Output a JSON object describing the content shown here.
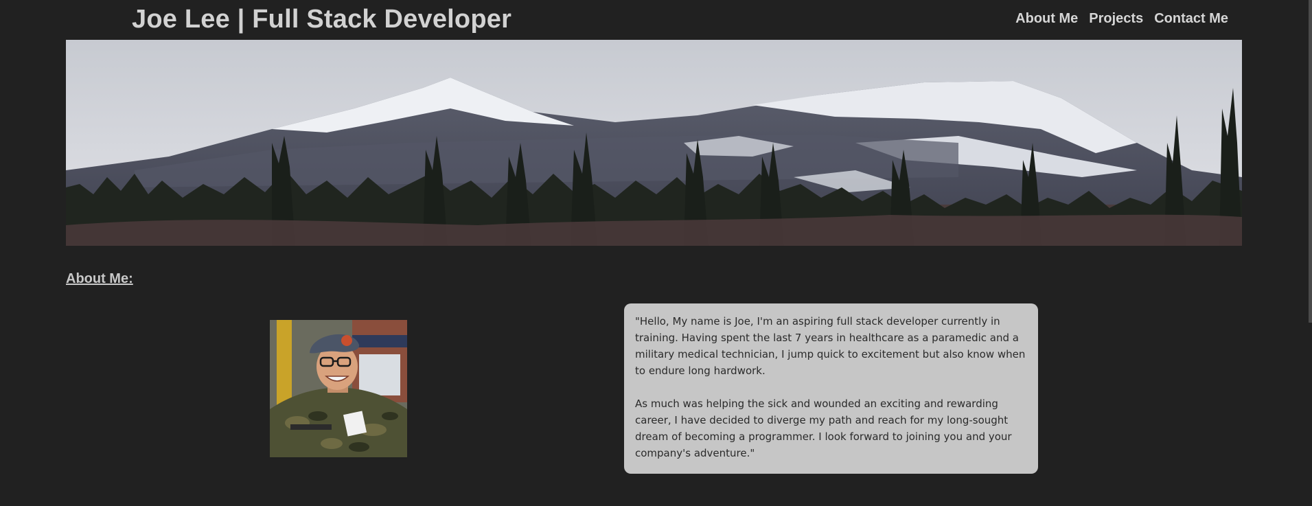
{
  "header": {
    "title": "Joe Lee | Full Stack Developer",
    "nav": [
      {
        "label": "About Me"
      },
      {
        "label": "Projects"
      },
      {
        "label": "Contact Me"
      }
    ]
  },
  "about": {
    "heading": "About Me:",
    "paragraphs": [
      "\"Hello, My name is Joe, I'm an aspiring full stack developer currently in training. Having spent the last 7 years in healthcare as a paramedic and a military medical technician, I jump quick to excitement but also know when to endure long hardwork.",
      "As much was helping the sick and wounded an exciting and rewarding career, I have decided to diverge my path and reach for my long-sought dream of becoming a programmer. I look forward to joining you and your company's adventure.\""
    ]
  },
  "colors": {
    "background": "#212121",
    "header_text": "#d2d2d2",
    "card_background": "#c6c6c6",
    "card_text": "#2a2a2a"
  }
}
